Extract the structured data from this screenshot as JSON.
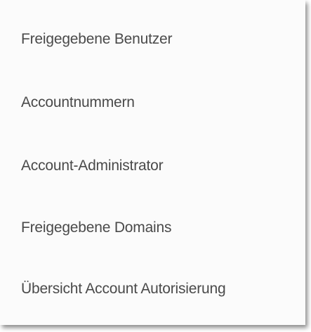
{
  "menu": {
    "items": [
      {
        "label": "Freigegebene Benutzer"
      },
      {
        "label": "Accountnummern"
      },
      {
        "label": "Account-Administrator"
      },
      {
        "label": "Freigegebene Domains"
      },
      {
        "label": "Übersicht Account Autorisierung"
      }
    ]
  }
}
